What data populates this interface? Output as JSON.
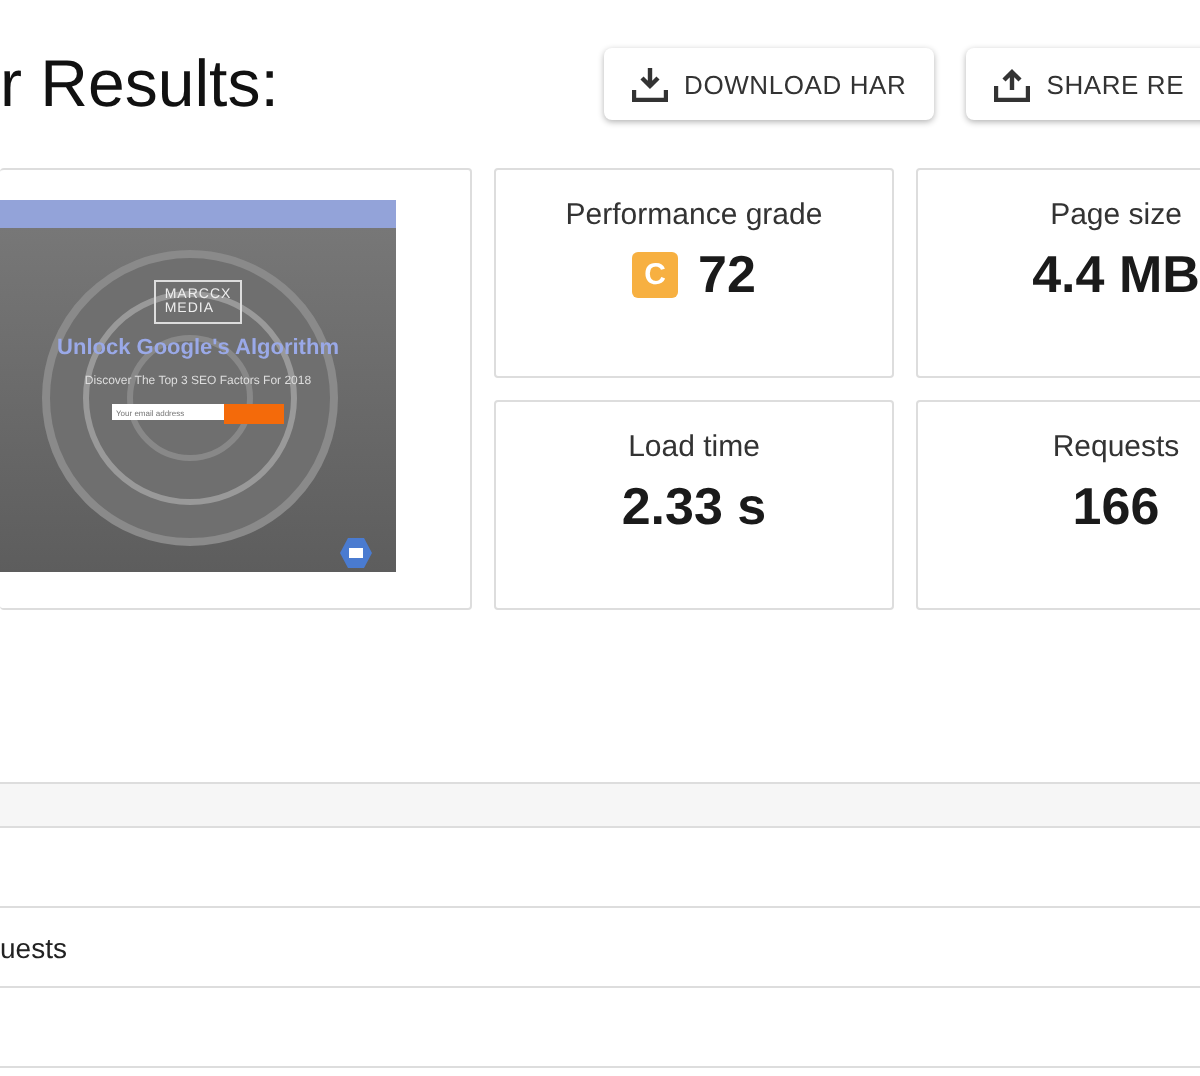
{
  "heading": "r Results:",
  "buttons": [
    {
      "kind": "download",
      "label": "DOWNLOAD HAR"
    },
    {
      "kind": "share",
      "label": "SHARE RE"
    }
  ],
  "preview": {
    "logo": [
      "MARCCX",
      "MEDIA"
    ],
    "headline": "Unlock Google's Algorithm",
    "subline": "Discover The Top 3 SEO Factors For 2018",
    "email_placeholder": "Your email address"
  },
  "metrics": [
    {
      "kind": "grade",
      "label": "Performance grade",
      "grade": "C",
      "color": "#f7b041",
      "value": "72"
    },
    {
      "kind": "plain",
      "label": "Page size",
      "value": "4.4 MB"
    },
    {
      "kind": "plain",
      "label": "Load time",
      "value": "2.33 s"
    },
    {
      "kind": "plain",
      "label": "Requests",
      "value": "166"
    }
  ],
  "table": {
    "rows": [
      {
        "cell": ""
      },
      {
        "cell": "uests"
      },
      {
        "cell": ""
      }
    ]
  }
}
